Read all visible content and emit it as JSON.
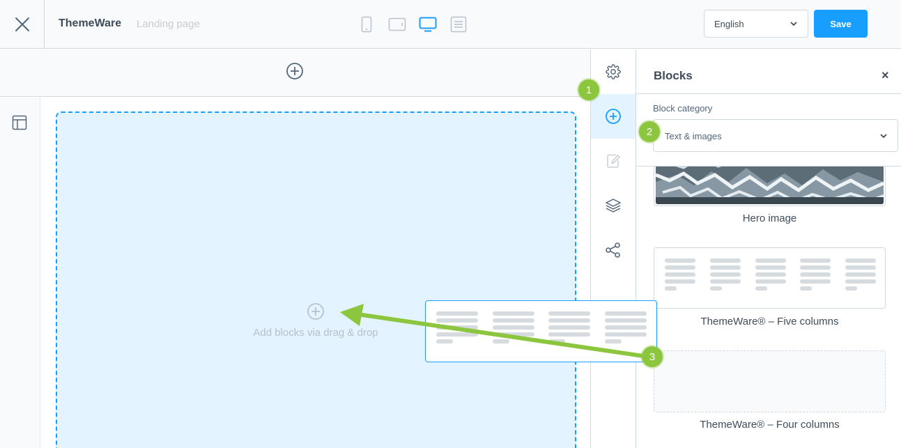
{
  "topbar": {
    "app_title": "ThemeWare",
    "page_name": "Landing page",
    "language": "English",
    "save_label": "Save"
  },
  "canvas": {
    "drop_text": "Add blocks via drag & drop"
  },
  "sidebar": {
    "title": "Blocks",
    "close": "×",
    "category_label": "Block category",
    "category_value": "Text & images",
    "blocks": [
      {
        "label": "Hero image"
      },
      {
        "label": "ThemeWare® – Five columns"
      },
      {
        "label": "ThemeWare® – Four columns"
      }
    ]
  },
  "callouts": [
    "1",
    "2",
    "3"
  ],
  "colors": {
    "accent": "#189eff",
    "callout": "#8cc63f",
    "dropzone": "#e3f3ff"
  }
}
